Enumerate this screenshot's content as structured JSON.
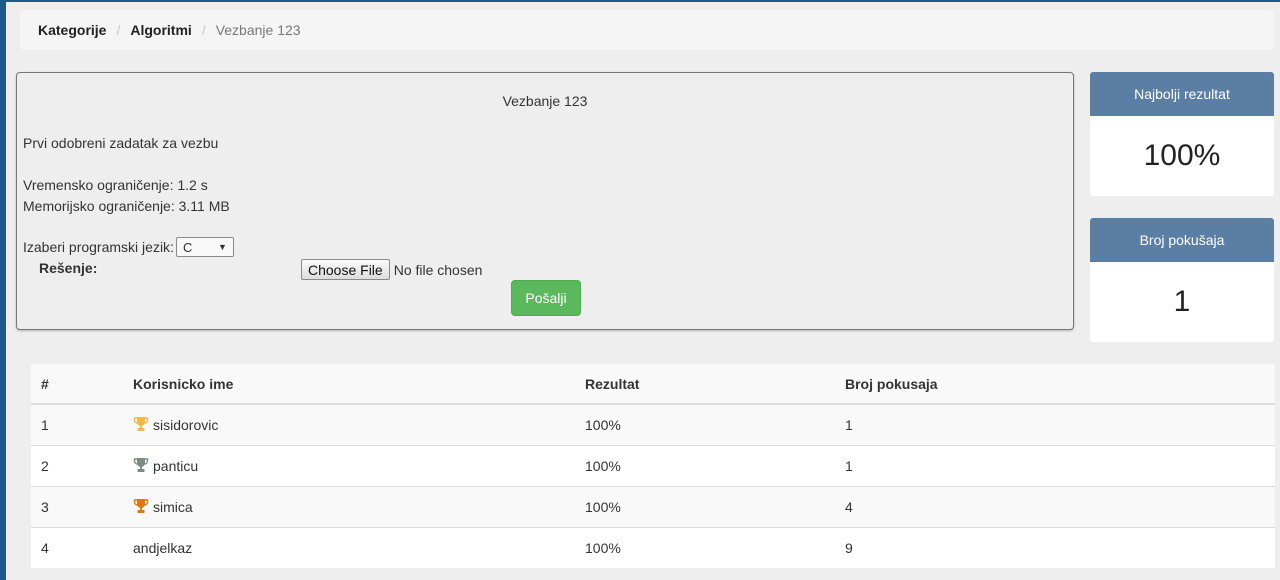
{
  "breadcrumb": {
    "items": [
      "Kategorije",
      "Algoritmi"
    ],
    "current": "Vezbanje 123",
    "separator": "/"
  },
  "task": {
    "title": "Vezbanje 123",
    "description": "Prvi odobreni zadatak za vezbu",
    "time_limit": "Vremensko ograničenje: 1.2 s",
    "memory_limit": "Memorijsko ograničenje: 3.11 MB",
    "language_label": "Izaberi programski jezik:",
    "language_selected": "C",
    "solution_label": "Rešenje:",
    "file_button_label": "Choose File",
    "file_status": "No file chosen",
    "submit_label": "Pošalji"
  },
  "best_score": {
    "title": "Najbolji rezultat",
    "value": "100%"
  },
  "attempts": {
    "title": "Broj pokušaja",
    "value": "1"
  },
  "results": {
    "headers": [
      "#",
      "Korisnicko ime",
      "Rezultat",
      "Broj pokusaja"
    ],
    "rows": [
      {
        "rank": "1",
        "user": "sisidorovic",
        "score": "100%",
        "attempts": "1",
        "trophy": "gold-trophy-icon"
      },
      {
        "rank": "2",
        "user": "panticu",
        "score": "100%",
        "attempts": "1",
        "trophy": "silver-trophy-icon"
      },
      {
        "rank": "3",
        "user": "simica",
        "score": "100%",
        "attempts": "4",
        "trophy": "bronze-trophy-icon"
      },
      {
        "rank": "4",
        "user": "andjelkaz",
        "score": "100%",
        "attempts": "9",
        "trophy": ""
      }
    ]
  },
  "colors": {
    "frame_border": "#1f5a8c",
    "card_header": "#5b7ea4",
    "submit_green": "#5cb85c",
    "trophy_gold": "#f2b84b",
    "trophy_silver": "#7d8c80",
    "trophy_bronze": "#d97b15"
  }
}
